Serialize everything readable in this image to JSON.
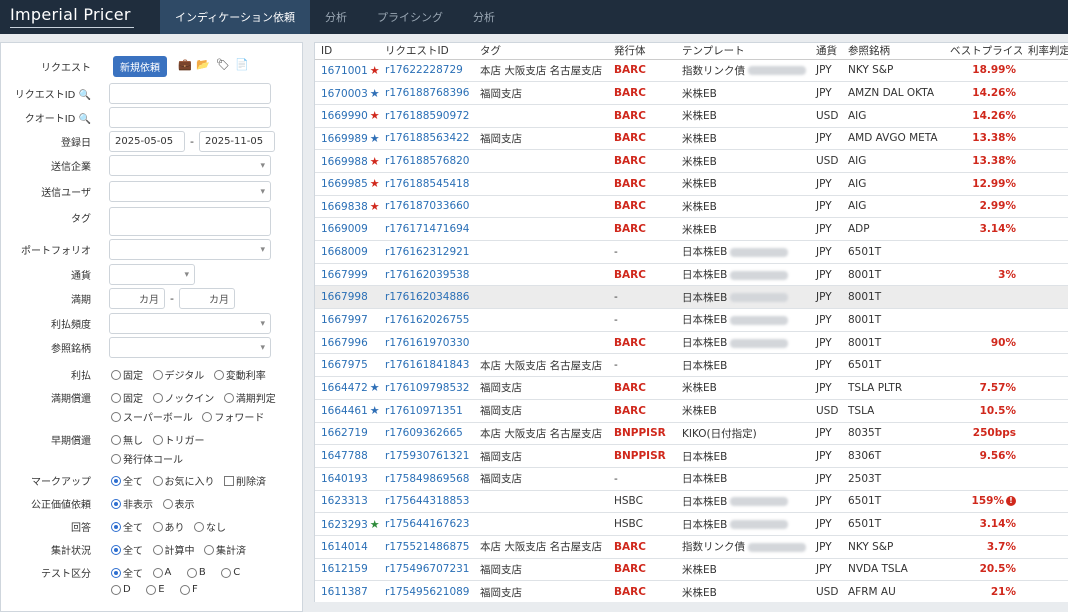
{
  "app": {
    "title": "Imperial Pricer"
  },
  "nav": {
    "tabs": [
      "インディケーション依頼",
      "分析",
      "プライシング",
      "分析"
    ]
  },
  "filters": {
    "request_label": "リクエスト",
    "new_button": "新規依頼",
    "request_id_label": "リクエストID",
    "quote_id_label": "クオートID",
    "date_label": "登録日",
    "date_from": "2025-05-05",
    "date_sep": "-",
    "date_to": "2025-11-05",
    "company_label": "送信企業",
    "user_label": "送信ユーザ",
    "tag_label": "タグ",
    "portfolio_label": "ポートフォリオ",
    "currency_label": "通貨",
    "term_label": "満期",
    "term_unit": "カ月",
    "term_sep": "-",
    "coupon_freq_label": "利払頻度",
    "ref_label": "参照銘柄",
    "coupon_label": "利払",
    "coupon_opts": [
      "固定",
      "デジタル",
      "変動利率"
    ],
    "redemption_label": "満期償還",
    "redemption_opts": [
      "固定",
      "ノックイン",
      "満期判定",
      "スーパーボール",
      "フォワード"
    ],
    "early_label": "早期償還",
    "early_opts": [
      "無し",
      "トリガー",
      "発行体コール"
    ],
    "markup_label": "マークアップ",
    "markup_opts": [
      "全て",
      "お気に入り",
      "削除済"
    ],
    "fair_label": "公正価値依頼",
    "fair_opts": [
      "非表示",
      "表示"
    ],
    "answer_label": "回答",
    "answer_opts": [
      "全て",
      "あり",
      "なし"
    ],
    "agg_label": "集計状況",
    "agg_opts": [
      "全て",
      "計算中",
      "集計済"
    ],
    "test_label": "テスト区分",
    "test_opts": [
      "全て",
      "A",
      "B",
      "C",
      "D",
      "E",
      "F"
    ]
  },
  "table": {
    "headers": [
      "ID",
      "リクエストID",
      "タグ",
      "発行体",
      "テンプレート",
      "通貨",
      "参照銘柄",
      "ベストプライス",
      "利率判定"
    ],
    "rows": [
      {
        "id": "1671001",
        "star": "red",
        "req": "r17622228729",
        "tag": "本店 大阪支店 名古屋支店",
        "issuer": "BARC",
        "tmpl": "指数リンク債",
        "blur": true,
        "ccy": "JPY",
        "ref": "NKY S&P",
        "price": "18.99%"
      },
      {
        "id": "1670003",
        "star": "blue",
        "req": "r176188768396",
        "tag": "福岡支店",
        "issuer": "BARC",
        "tmpl": "米株EB",
        "blur": false,
        "ccy": "JPY",
        "ref": "AMZN DAL OKTA",
        "price": "14.26%"
      },
      {
        "id": "1669990",
        "star": "red",
        "req": "r176188590972",
        "tag": "",
        "issuer": "BARC",
        "tmpl": "米株EB",
        "blur": false,
        "ccy": "USD",
        "ref": "AIG",
        "price": "14.26%"
      },
      {
        "id": "1669989",
        "star": "blue",
        "req": "r176188563422",
        "tag": "福岡支店",
        "issuer": "BARC",
        "tmpl": "米株EB",
        "blur": false,
        "ccy": "JPY",
        "ref": "AMD AVGO META",
        "price": "13.38%"
      },
      {
        "id": "1669988",
        "star": "red",
        "req": "r176188576820",
        "tag": "",
        "issuer": "BARC",
        "tmpl": "米株EB",
        "blur": false,
        "ccy": "USD",
        "ref": "AIG",
        "price": "13.38%"
      },
      {
        "id": "1669985",
        "star": "red",
        "req": "r176188545418",
        "tag": "",
        "issuer": "BARC",
        "tmpl": "米株EB",
        "blur": false,
        "ccy": "JPY",
        "ref": "AIG",
        "price": "12.99%"
      },
      {
        "id": "1669838",
        "star": "red",
        "req": "r176187033660",
        "tag": "",
        "issuer": "BARC",
        "tmpl": "米株EB",
        "blur": false,
        "ccy": "JPY",
        "ref": "AIG",
        "price": "2.99%"
      },
      {
        "id": "1669009",
        "star": "",
        "req": "r176171471694",
        "tag": "",
        "issuer": "BARC",
        "tmpl": "米株EB",
        "blur": false,
        "ccy": "JPY",
        "ref": "ADP",
        "price": "3.14%"
      },
      {
        "id": "1668009",
        "star": "",
        "req": "r176162312921",
        "tag": "",
        "issuer": "-",
        "tmpl": "日本株EB",
        "blur": true,
        "ccy": "JPY",
        "ref": "6501T",
        "price": ""
      },
      {
        "id": "1667999",
        "star": "",
        "req": "r176162039538",
        "tag": "",
        "issuer": "BARC",
        "tmpl": "日本株EB",
        "blur": true,
        "ccy": "JPY",
        "ref": "8001T",
        "price": "3%"
      },
      {
        "id": "1667998",
        "star": "",
        "req": "r176162034886",
        "tag": "",
        "issuer": "-",
        "tmpl": "日本株EB",
        "blur": true,
        "ccy": "JPY",
        "ref": "8001T",
        "price": "",
        "hl": true
      },
      {
        "id": "1667997",
        "star": "",
        "req": "r176162026755",
        "tag": "",
        "issuer": "-",
        "tmpl": "日本株EB",
        "blur": true,
        "ccy": "JPY",
        "ref": "8001T",
        "price": ""
      },
      {
        "id": "1667996",
        "star": "",
        "req": "r176161970330",
        "tag": "",
        "issuer": "BARC",
        "tmpl": "日本株EB",
        "blur": true,
        "ccy": "JPY",
        "ref": "8001T",
        "price": "90%"
      },
      {
        "id": "1667975",
        "star": "",
        "req": "r176161841843",
        "tag": "本店 大阪支店 名古屋支店",
        "issuer": "-",
        "tmpl": "日本株EB",
        "blur": false,
        "ccy": "JPY",
        "ref": "6501T",
        "price": ""
      },
      {
        "id": "1664472",
        "star": "blue",
        "req": "r176109798532",
        "tag": "福岡支店",
        "issuer": "BARC",
        "tmpl": "米株EB",
        "blur": false,
        "ccy": "JPY",
        "ref": "TSLA PLTR",
        "price": "7.57%"
      },
      {
        "id": "1664461",
        "star": "blue",
        "req": "r17610971351",
        "tag": "福岡支店",
        "issuer": "BARC",
        "tmpl": "米株EB",
        "blur": false,
        "ccy": "USD",
        "ref": "TSLA",
        "price": "10.5%"
      },
      {
        "id": "1662719",
        "star": "",
        "req": "r17609362665",
        "tag": "本店 大阪支店 名古屋支店",
        "issuer": "BNPPISR",
        "tmpl": "KIKO(日付指定)",
        "blur": false,
        "ccy": "JPY",
        "ref": "8035T",
        "price": "250bps"
      },
      {
        "id": "1647788",
        "star": "",
        "req": "r175930761321",
        "tag": "福岡支店",
        "issuer": "BNPPISR",
        "tmpl": "日本株EB",
        "blur": false,
        "ccy": "JPY",
        "ref": "8306T",
        "price": "9.56%"
      },
      {
        "id": "1640193",
        "star": "",
        "req": "r175849869568",
        "tag": "福岡支店",
        "issuer": "-",
        "tmpl": "日本株EB",
        "blur": false,
        "ccy": "JPY",
        "ref": "2503T",
        "price": ""
      },
      {
        "id": "1623313",
        "star": "",
        "req": "r175644318853",
        "tag": "",
        "issuer": "HSBC",
        "plain": true,
        "tmpl": "日本株EB",
        "blur": true,
        "ccy": "JPY",
        "ref": "6501T",
        "price": "159%",
        "warn": "!"
      },
      {
        "id": "1623293",
        "star": "green",
        "req": "r175644167623",
        "tag": "",
        "issuer": "HSBC",
        "plain": true,
        "tmpl": "日本株EB",
        "blur": true,
        "ccy": "JPY",
        "ref": "6501T",
        "price": "3.14%"
      },
      {
        "id": "1614014",
        "star": "",
        "req": "r175521486875",
        "tag": "本店 大阪支店 名古屋支店",
        "issuer": "BARC",
        "tmpl": "指数リンク債",
        "blur": true,
        "ccy": "JPY",
        "ref": "NKY S&P",
        "price": "3.7%"
      },
      {
        "id": "1612159",
        "star": "",
        "req": "r175496707231",
        "tag": "福岡支店",
        "issuer": "BARC",
        "tmpl": "米株EB",
        "blur": false,
        "ccy": "JPY",
        "ref": "NVDA TSLA",
        "price": "20.5%"
      },
      {
        "id": "1611387",
        "star": "",
        "req": "r175495621089",
        "tag": "福岡支店",
        "issuer": "BARC",
        "tmpl": "米株EB",
        "blur": false,
        "ccy": "USD",
        "ref": "AFRM AU",
        "price": "21%"
      }
    ]
  },
  "colors": {
    "nav_bg": "#1f2d3d",
    "nav_active": "#2f4a66",
    "link": "#2a6fb6",
    "issuer": "#d0281c",
    "star_red": "#d0281c",
    "star_blue": "#2f6fb6",
    "star_green": "#2e8b3a"
  }
}
